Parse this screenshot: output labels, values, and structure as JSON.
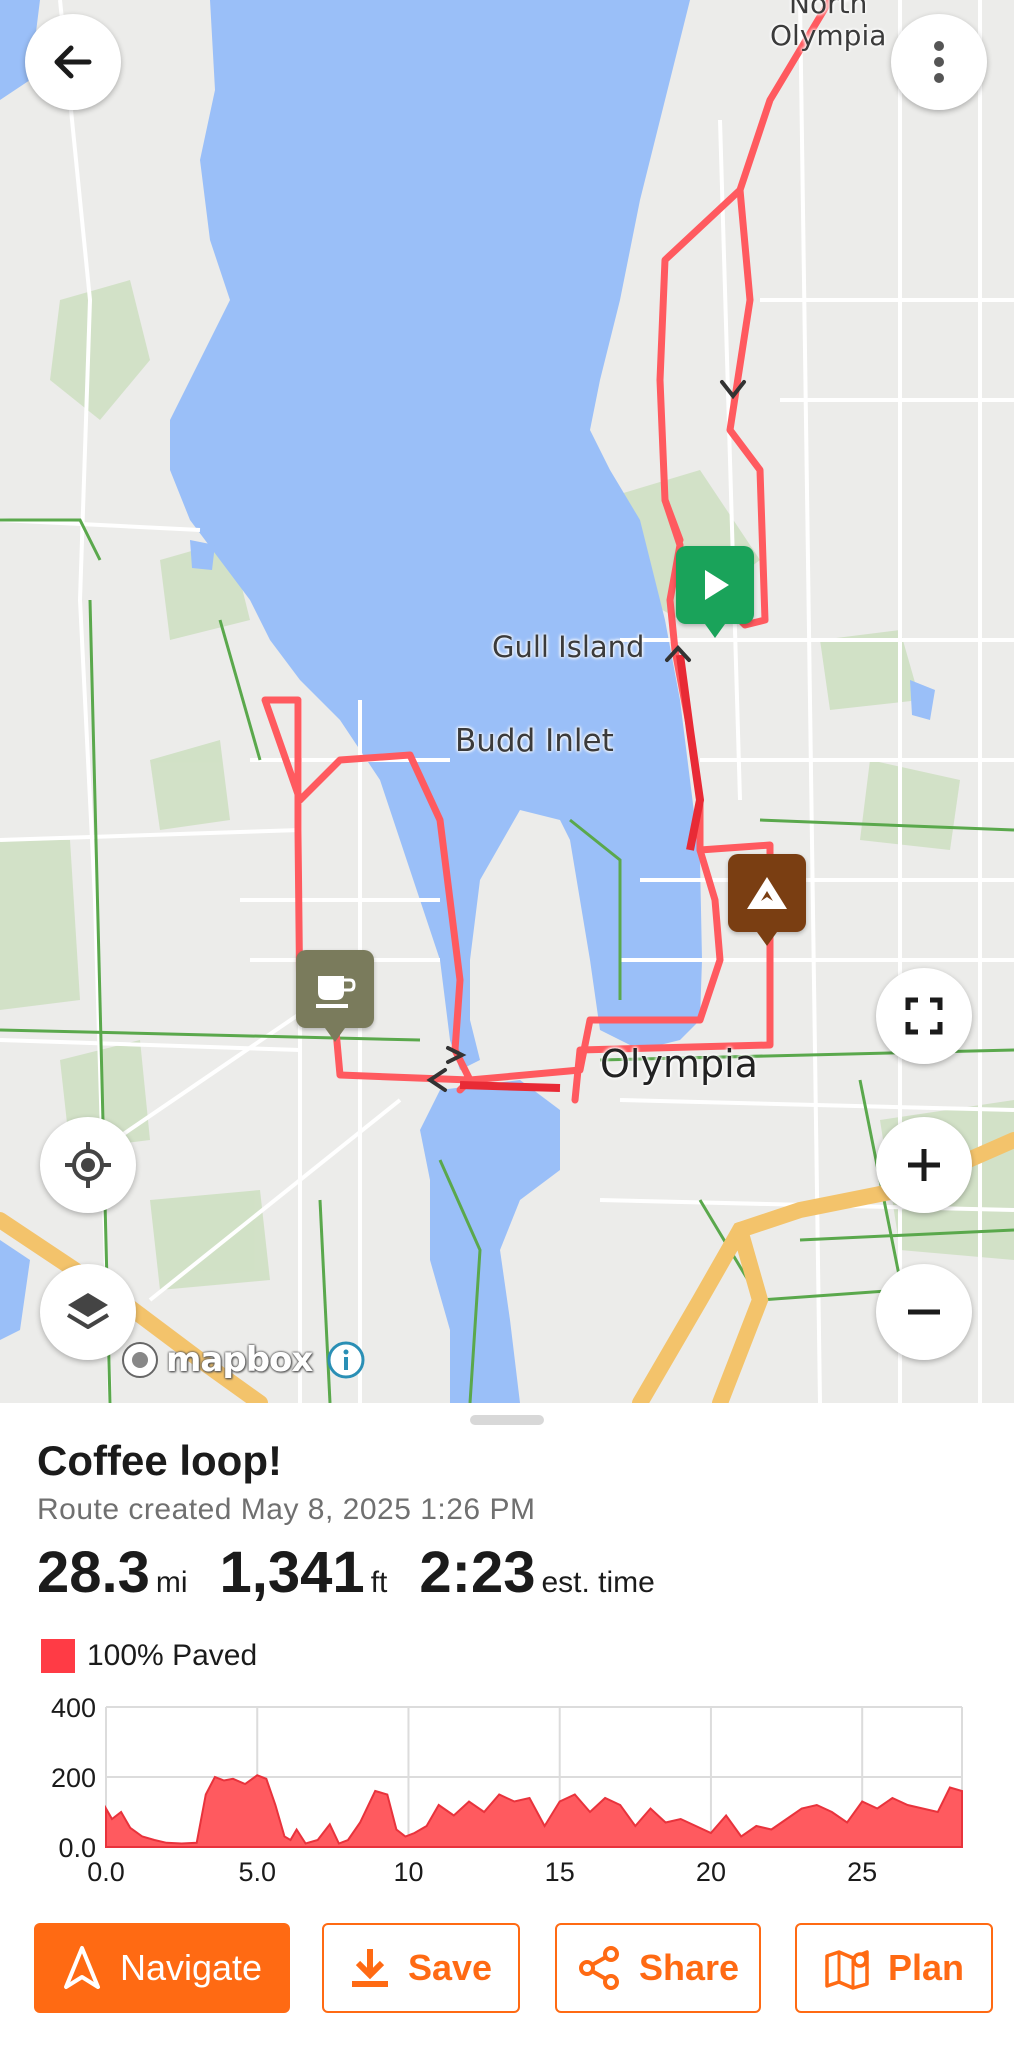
{
  "map": {
    "labels": {
      "north_olympia": "North\nOlympia",
      "gull_island": "Gull Island",
      "budd_inlet": "Budd Inlet",
      "olympia": "Olympia"
    },
    "attribution": "mapbox",
    "colors": {
      "water": "#9abff8",
      "land": "#ececea",
      "park": "#cfe0c3",
      "route": "#ff5a5f",
      "highway": "#f3c36b",
      "trail": "#5aa84c"
    },
    "markers": {
      "start": {
        "icon": "play-icon",
        "color": "#1aa35a"
      },
      "summit": {
        "icon": "mountain-icon",
        "color": "#7a3e12"
      },
      "cafe": {
        "icon": "coffee-cup-icon",
        "color": "#7a7b5c"
      }
    },
    "controls": [
      "back-arrow-icon",
      "more-vertical-icon",
      "fullscreen-icon",
      "zoom-in-icon",
      "zoom-out-icon",
      "locate-icon",
      "layers-icon"
    ]
  },
  "route": {
    "title": "Coffee loop!",
    "created": "Route created May 8, 2025 1:26 PM",
    "distance_value": "28.3",
    "distance_unit": "mi",
    "elevation_value": "1,341",
    "elevation_unit": "ft",
    "time_value": "2:23",
    "time_unit": "est. time",
    "surface_label": "100% Paved",
    "surface_color": "#ff3b45"
  },
  "chart_data": {
    "type": "area",
    "title": "",
    "xlabel": "",
    "ylabel": "",
    "xlim": [
      0,
      28.3
    ],
    "ylim": [
      0,
      400
    ],
    "xticks": [
      "0.0",
      "5.0",
      "10",
      "15",
      "20",
      "25"
    ],
    "xtick_values": [
      0,
      5,
      10,
      15,
      20,
      25
    ],
    "yticks": [
      "0.0",
      "200",
      "400"
    ],
    "ytick_values": [
      0,
      200,
      400
    ],
    "grid": true,
    "legend": "none",
    "color": "#ff5a5f",
    "series": [
      {
        "x": [
          0,
          0.2,
          0.5,
          0.8,
          1.2,
          1.6,
          2.0,
          2.5,
          3.0,
          3.3,
          3.6,
          3.9,
          4.2,
          4.6,
          5.0,
          5.3,
          5.6,
          5.9,
          6.1,
          6.3,
          6.6,
          7.0,
          7.4,
          7.7,
          8.0,
          8.4,
          8.9,
          9.3,
          9.6,
          9.9,
          10.2,
          10.6,
          11.0,
          11.5,
          12.0,
          12.5,
          13.0,
          13.5,
          14.0,
          14.5,
          15.0,
          15.5,
          16.0,
          16.5,
          17.0,
          17.5,
          18.0,
          18.5,
          19.0,
          19.5,
          20.0,
          20.5,
          21.0,
          21.5,
          22.0,
          22.5,
          23.0,
          23.5,
          24.0,
          24.5,
          25.0,
          25.5,
          26.0,
          26.5,
          27.0,
          27.5,
          27.9,
          28.3
        ],
        "y": [
          110,
          80,
          100,
          55,
          30,
          20,
          12,
          10,
          12,
          150,
          200,
          190,
          195,
          180,
          205,
          195,
          120,
          30,
          20,
          50,
          10,
          20,
          65,
          10,
          20,
          70,
          160,
          150,
          50,
          30,
          40,
          60,
          120,
          90,
          130,
          100,
          150,
          130,
          140,
          60,
          130,
          150,
          100,
          140,
          120,
          60,
          110,
          70,
          80,
          60,
          40,
          90,
          30,
          60,
          50,
          80,
          110,
          120,
          100,
          70,
          130,
          110,
          140,
          120,
          110,
          100,
          170,
          160
        ]
      }
    ]
  },
  "actions": {
    "navigate": "Navigate",
    "save": "Save",
    "share": "Share",
    "plan": "Plan",
    "accent": "#ff6a13"
  }
}
